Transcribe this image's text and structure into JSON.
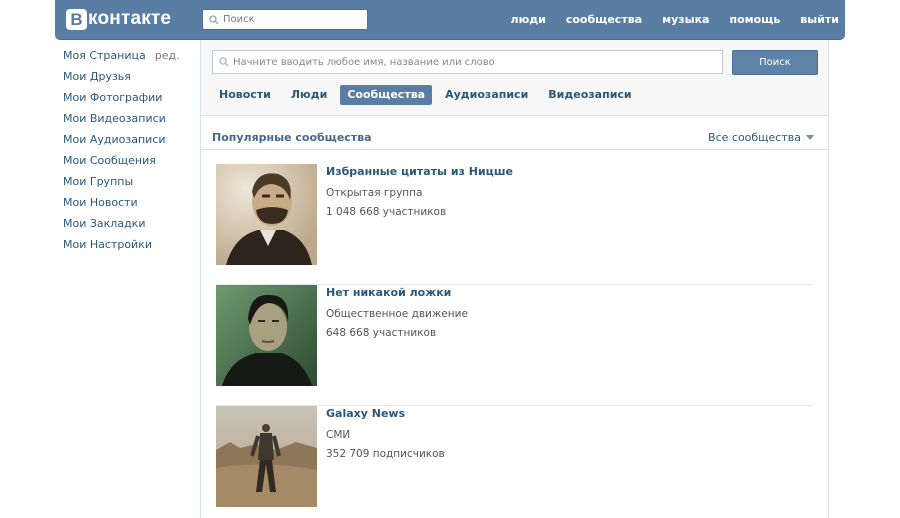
{
  "header": {
    "logo_letter": "В",
    "logo_text": "контакте",
    "search_placeholder": "Поиск",
    "nav": [
      "люди",
      "сообщества",
      "музыка",
      "помощь",
      "выйти"
    ]
  },
  "sidebar": {
    "edit_label": "ред.",
    "items": [
      {
        "label": "Моя Страница"
      },
      {
        "label": "Мои Друзья"
      },
      {
        "label": "Мои Фотографии"
      },
      {
        "label": "Мои Видеозаписи"
      },
      {
        "label": "Мои Аудиозаписи"
      },
      {
        "label": "Мои Сообщения"
      },
      {
        "label": "Мои Группы"
      },
      {
        "label": "Мои Новости"
      },
      {
        "label": "Мои Закладки"
      },
      {
        "label": "Мои Настройки"
      }
    ]
  },
  "search": {
    "placeholder": "Начните вводить любое имя, название или слово",
    "button_label": "Поиск"
  },
  "tabs": [
    {
      "label": "Новости",
      "active": false
    },
    {
      "label": "Люди",
      "active": false
    },
    {
      "label": "Сообщества",
      "active": true
    },
    {
      "label": "Аудиозаписи",
      "active": false
    },
    {
      "label": "Видеозаписи",
      "active": false
    }
  ],
  "section": {
    "title": "Популярные сообщества",
    "filter_label": "Все сообщества"
  },
  "groups": [
    {
      "name": "Избранные цитаты из Ницше",
      "type": "Открытая группа",
      "count": "1 048 668 участников",
      "avatar": "portrait-sepia"
    },
    {
      "name": "Нет никакой ложки",
      "type": "Общественное движение",
      "count": "648 668 участников",
      "avatar": "portrait-green"
    },
    {
      "name": "Galaxy News",
      "type": "СМИ",
      "count": "352 709 подписчиков",
      "avatar": "wasteland-figure"
    }
  ],
  "colors": {
    "header_bg": "#597da3",
    "link": "#2b587a",
    "section_title": "#45688e",
    "button_bg": "#5e82a8"
  }
}
